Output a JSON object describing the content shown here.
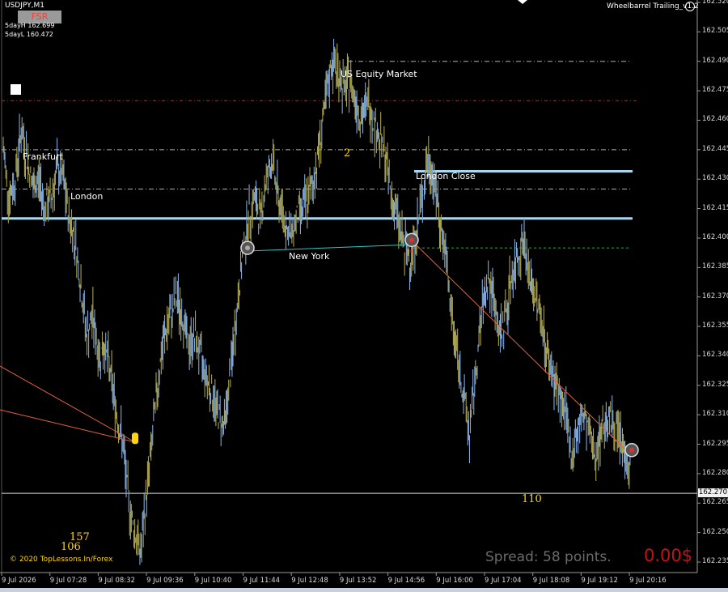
{
  "header": {
    "symbol": "USDJPY,M1",
    "day_high": "5dayH 162.699",
    "day_low": "5dayL 160.472",
    "fsr_label": "FSR",
    "indicator": "Wheelbarrel Trailing_v1.2"
  },
  "sessions": {
    "frankfurt": "Frankfurt",
    "london": "London",
    "new_york": "New York",
    "us_equity": "US Equity Market",
    "london_close": "London Close"
  },
  "annotations": {
    "count_2": "2",
    "count_110": "110",
    "count_157": "157",
    "count_106": "106"
  },
  "footer": {
    "copyright": "© 2020 TopLessons.In/Forex",
    "spread": "Spread: 58 points.",
    "profit": "0.00$"
  },
  "colors": {
    "background": "#000000",
    "bar_up": "#7fa7d8",
    "bar_down": "#a8a04a",
    "session_line": "#a8d8f0",
    "trend_line": "#e06040",
    "accent_yellow": "#ffd60a",
    "profit_red": "#c0141c"
  },
  "chart_data": {
    "type": "line",
    "title": "USDJPY,M1",
    "y_ticks": [
      "162.520",
      "162.505",
      "162.490",
      "162.475",
      "162.460",
      "162.445",
      "162.430",
      "162.415",
      "162.400",
      "162.385",
      "162.370",
      "162.355",
      "162.340",
      "162.325",
      "162.310",
      "162.295",
      "162.280",
      "162.265",
      "162.250",
      "162.235"
    ],
    "ylim": [
      162.235,
      162.52
    ],
    "x_ticks": [
      "9 Jul 2026",
      "9 Jul 07:28",
      "9 Jul 08:32",
      "9 Jul 09:36",
      "9 Jul 10:40",
      "9 Jul 11:44",
      "9 Jul 12:48",
      "9 Jul 13:52",
      "9 Jul 14:56",
      "9 Jul 16:00",
      "9 Jul 17:04",
      "9 Jul 18:08",
      "9 Jul 19:12",
      "9 Jul 20:16"
    ],
    "current_price": "162.270",
    "series": [
      {
        "values": [
          162.445,
          162.42,
          162.43,
          162.455,
          162.44,
          162.425,
          162.43,
          162.415,
          162.42,
          162.435,
          162.43,
          162.41,
          162.4,
          162.375,
          162.35,
          162.36,
          162.34,
          162.345,
          162.33,
          162.31,
          162.295,
          162.265,
          162.25,
          162.24,
          162.27,
          162.3,
          162.33,
          162.35,
          162.36,
          162.37,
          162.36,
          162.345,
          162.35,
          162.34,
          162.33,
          162.32,
          162.31,
          162.305,
          162.33,
          162.36,
          162.39,
          162.41,
          162.42,
          162.41,
          162.43,
          162.44,
          162.42,
          162.41,
          162.4,
          162.41,
          162.415,
          162.42,
          162.43,
          162.45,
          162.47,
          162.49,
          162.485,
          162.475,
          162.48,
          162.47,
          162.46,
          162.47,
          162.46,
          162.45,
          162.44,
          162.42,
          162.41,
          162.395,
          162.39,
          162.4,
          162.42,
          162.44,
          162.43,
          162.41,
          162.39,
          162.36,
          162.34,
          162.32,
          162.3,
          162.33,
          162.36,
          162.38,
          162.37,
          162.35,
          162.36,
          162.38,
          162.39,
          162.4,
          162.38,
          162.37,
          162.36,
          162.34,
          162.33,
          162.32,
          162.31,
          162.29,
          162.3,
          162.31,
          162.3,
          162.29,
          162.3,
          162.31,
          162.305,
          162.3,
          162.29,
          162.28
        ]
      }
    ],
    "horizontal_levels": [
      162.47,
      162.445,
      162.425,
      162.41,
      162.395,
      162.49,
      162.27
    ],
    "markers": [
      {
        "type": "circle",
        "x": "9 Jul 11:44",
        "y": 162.395
      },
      {
        "type": "circle",
        "x": "9 Jul 14:56",
        "y": 162.399
      },
      {
        "type": "circle",
        "x": "9 Jul 20:16",
        "y": 162.292
      },
      {
        "type": "yellow",
        "x": "9 Jul 08:32",
        "y": 162.298
      }
    ]
  }
}
